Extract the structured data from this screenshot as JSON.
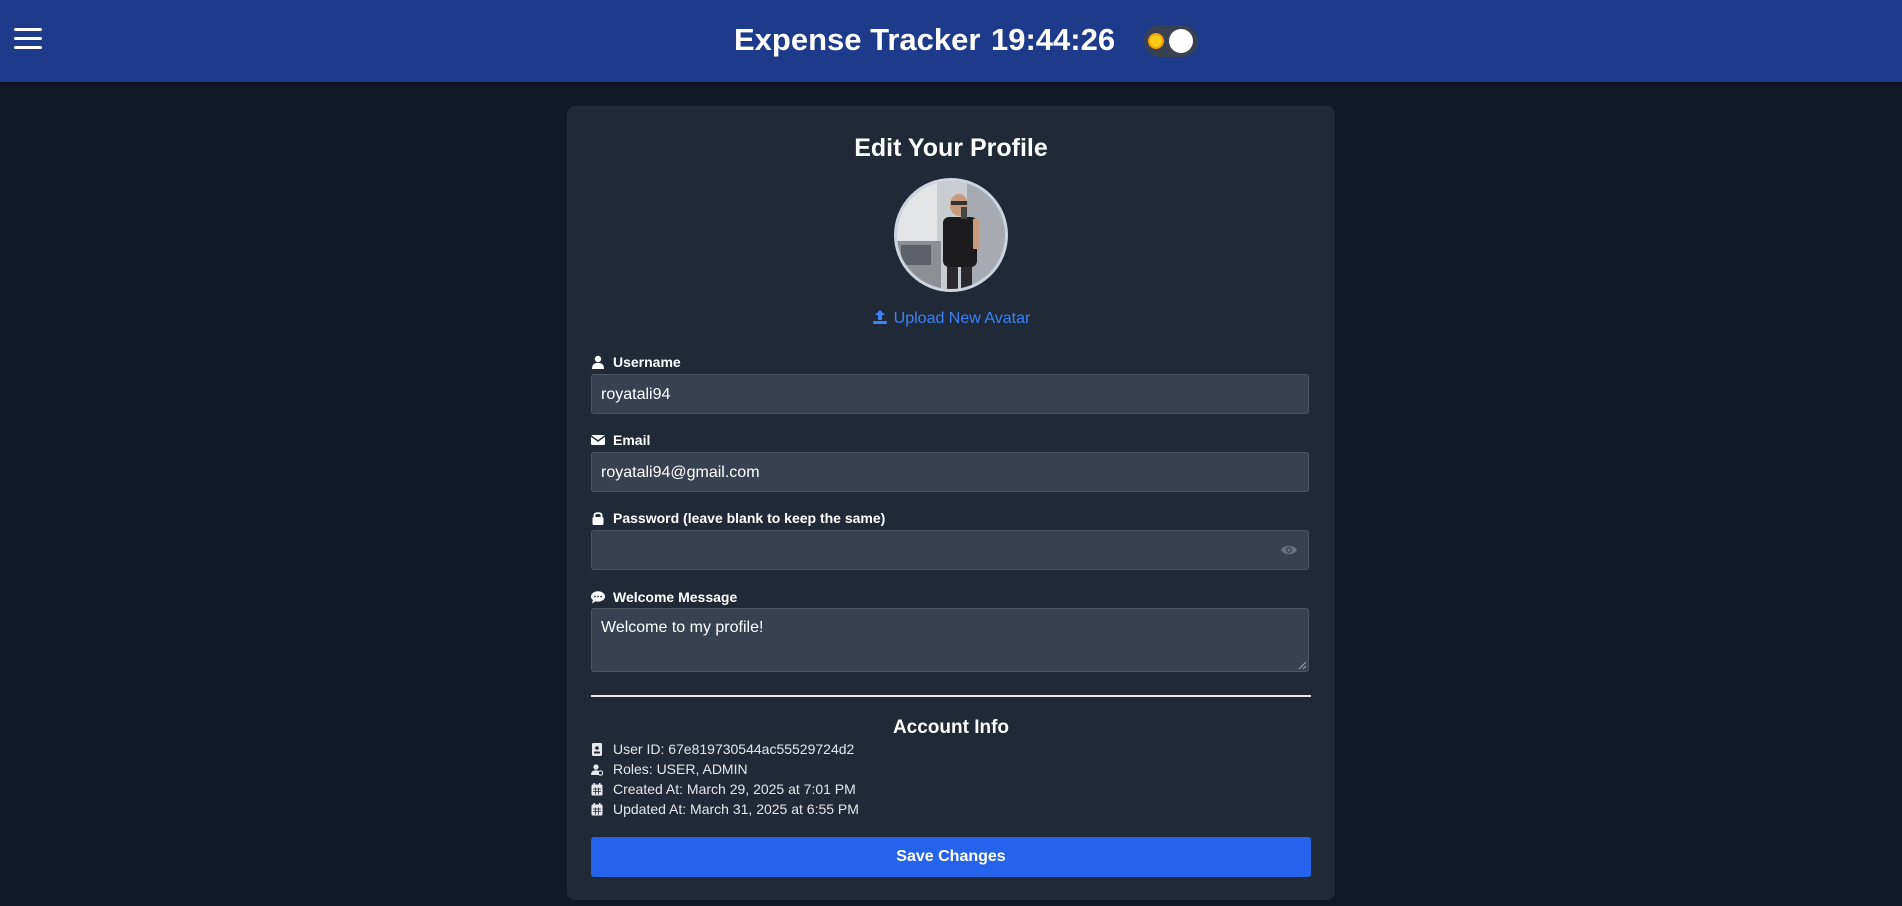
{
  "header": {
    "title": "Expense Tracker",
    "clock": "19:44:26"
  },
  "profile": {
    "heading": "Edit Your Profile",
    "upload_label": "Upload New Avatar",
    "fields": {
      "username": {
        "label": "Username",
        "value": "royatali94"
      },
      "email": {
        "label": "Email",
        "value": "royatali94@gmail.com"
      },
      "password": {
        "label": "Password (leave blank to keep the same)",
        "value": ""
      },
      "welcome": {
        "label": "Welcome Message",
        "value": "Welcome to my profile!"
      }
    }
  },
  "account_info": {
    "title": "Account Info",
    "user_id": "User ID: 67e819730544ac55529724d2",
    "roles": "Roles: USER, ADMIN",
    "created_at": "Created At: March 29, 2025 at 7:01 PM",
    "updated_at": "Updated At: March 31, 2025 at 6:55 PM"
  },
  "actions": {
    "save_label": "Save Changes"
  },
  "icons": {
    "menu": "hamburger-icon",
    "theme": "sun-icon",
    "upload": "upload-icon",
    "username": "user-icon",
    "email": "envelope-icon",
    "password": "lock-icon",
    "welcome": "comment-icon",
    "eye": "eye-icon",
    "user_id": "id-card-icon",
    "roles": "user-gear-icon",
    "calendar": "calendar-icon"
  },
  "colors": {
    "header_bg": "#1e3a8a",
    "page_bg": "#111827",
    "card_bg": "#1f2937",
    "input_bg": "#374151",
    "accent": "#2563eb",
    "link": "#3b82f6"
  }
}
